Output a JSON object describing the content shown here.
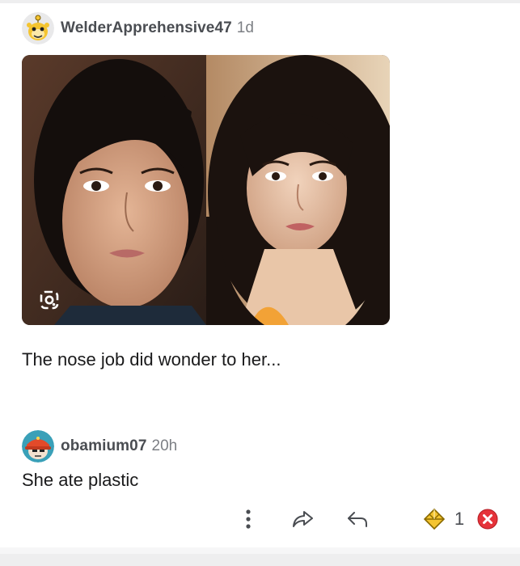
{
  "comments": [
    {
      "username": "WelderApprehensive47",
      "time": "1d",
      "avatar_icon": "snoo-avatar-yellow",
      "has_image": true,
      "image_overlay_icon": "lens-search-icon",
      "body": "The nose job did wonder to her..."
    },
    {
      "username": "obamium07",
      "time": "20h",
      "avatar_icon": "snoo-avatar-red-cap",
      "body": "She ate plastic"
    }
  ],
  "actions": {
    "more_icon": "more-vertical-icon",
    "share_icon": "share-arrow-icon",
    "reply_icon": "reply-arrow-icon",
    "award_icon": "award-icon",
    "score": "1",
    "vote_icon": "downvote-red-icon"
  },
  "colors": {
    "username": "#4a4d52",
    "time": "#7c7f84",
    "body": "#1a1a1b",
    "award": "#f4c430",
    "vote": "#e5333a"
  }
}
